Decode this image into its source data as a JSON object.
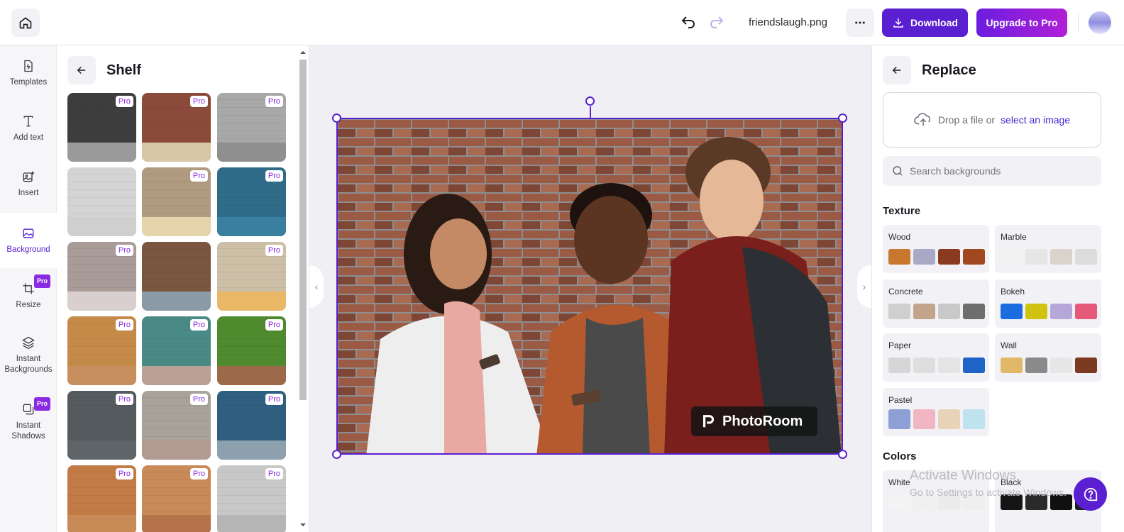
{
  "topbar": {
    "filename": "friendslaugh.png",
    "download_label": "Download",
    "upgrade_label": "Upgrade to Pro",
    "accent": "#5a1fd1"
  },
  "rail": {
    "items": [
      {
        "label": "Templates",
        "icon": "templates-icon",
        "pro": false
      },
      {
        "label": "Add text",
        "icon": "text-icon",
        "pro": false
      },
      {
        "label": "Insert",
        "icon": "insert-image-icon",
        "pro": false
      },
      {
        "label": "Background",
        "icon": "background-icon",
        "pro": false,
        "active": true
      },
      {
        "label": "Resize",
        "icon": "crop-icon",
        "pro": true
      },
      {
        "label": "Instant Backgrounds",
        "icon": "layers-icon",
        "pro": false
      },
      {
        "label": "Instant Shadows",
        "icon": "shadow-icon",
        "pro": true
      }
    ],
    "pro_badge": "Pro"
  },
  "shelf": {
    "title": "Shelf",
    "pro_label": "Pro",
    "tiles": [
      {
        "wall": "#3d3d3d",
        "floor": "#9a9a9a",
        "pro": true
      },
      {
        "wall": "#8b4a3a",
        "floor": "#d8c7a6",
        "pro": true
      },
      {
        "wall": "#a8a8a8",
        "floor": "#8f8f8f",
        "pro": true
      },
      {
        "wall": "#d4d4d4",
        "floor": "#cfcfcf",
        "pro": false
      },
      {
        "wall": "#b09a80",
        "floor": "#e5d3ab",
        "pro": true
      },
      {
        "wall": "#2f6c8a",
        "floor": "#3a7ea0",
        "pro": true
      },
      {
        "wall": "#a99c98",
        "floor": "#d9cfcf",
        "pro": true
      },
      {
        "wall": "#7a5640",
        "floor": "#8a9aa6",
        "pro": false
      },
      {
        "wall": "#cdbfa6",
        "floor": "#e9b866",
        "pro": true
      },
      {
        "wall": "#c58a48",
        "floor": "#c88f5e",
        "pro": true
      },
      {
        "wall": "#4a8a86",
        "floor": "#bba095",
        "pro": true
      },
      {
        "wall": "#4f8a2e",
        "floor": "#9c6a4a",
        "pro": true
      },
      {
        "wall": "#555a5e",
        "floor": "#5e6468",
        "pro": true
      },
      {
        "wall": "#a8a29a",
        "floor": "#b39a90",
        "pro": true
      },
      {
        "wall": "#2f5f80",
        "floor": "#8da0ae",
        "pro": true
      },
      {
        "wall": "#c37b46",
        "floor": "#c88a57",
        "pro": true
      },
      {
        "wall": "#c88a57",
        "floor": "#b47348",
        "pro": true
      },
      {
        "wall": "#c8c8c8",
        "floor": "#b5b5b5",
        "pro": true
      }
    ]
  },
  "canvas": {
    "watermark": "PhotoRoom"
  },
  "replace": {
    "title": "Replace",
    "drop_text": "Drop a file or",
    "drop_link": "select an image",
    "search_placeholder": "Search backgrounds",
    "texture_heading": "Texture",
    "colors_heading": "Colors",
    "categories": [
      {
        "label": "Wood",
        "swatches": [
          "#c8782e",
          "#a9a9c6",
          "#8a3a1e",
          "#a1481e"
        ]
      },
      {
        "label": "Marble",
        "swatches": [
          "#f1f1f1",
          "#e6e6e6",
          "#d9d3cc",
          "#dcdcdc"
        ]
      },
      {
        "label": "Concrete",
        "swatches": [
          "#cfcfcf",
          "#c2a48a",
          "#c9c9c9",
          "#6e6e6e"
        ]
      },
      {
        "label": "Bokeh",
        "swatches": [
          "#1a6de0",
          "#d2c210",
          "#b5a8d8",
          "#e45a78"
        ]
      },
      {
        "label": "Paper",
        "swatches": [
          "#d6d6d6",
          "#dedede",
          "#e4e4e4",
          "#1e63c6"
        ]
      },
      {
        "label": "Wall",
        "swatches": [
          "#e0b868",
          "#8a8a8a",
          "#e6e6e6",
          "#7a3b20"
        ]
      },
      {
        "label": "Pastel",
        "swatches": [
          "#8e9fd6",
          "#f2b6c2",
          "#e8d3b8",
          "#bfe2ef"
        ]
      }
    ],
    "colors": [
      {
        "label": "White"
      },
      {
        "label": "Black"
      }
    ]
  },
  "os_overlay": {
    "line1": "Activate Windows",
    "line2": "Go to Settings to activate Windows."
  }
}
